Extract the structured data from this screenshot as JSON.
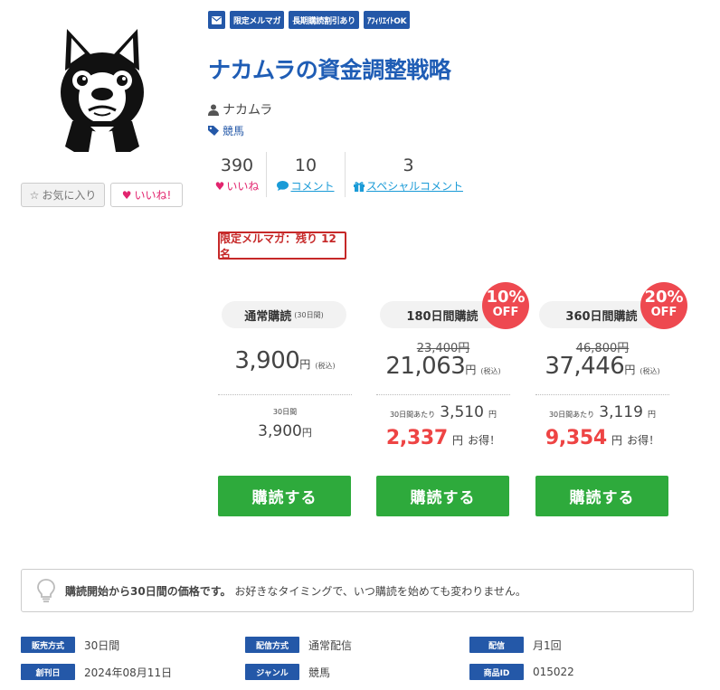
{
  "badges": [
    "限定メルマガ",
    "長期購読割引あり",
    "ｱﾌｨﾘｴｲﾄOK"
  ],
  "title": "ナカムラの資金調整戦略",
  "author": "ナカムラ",
  "genre": "競馬",
  "buttons": {
    "favorite": "お気に入り",
    "like": "いいね!"
  },
  "stats": [
    {
      "value": "390",
      "label": "いいね"
    },
    {
      "value": "10",
      "label": "コメント"
    },
    {
      "value": "3",
      "label": "スペシャルコメント"
    }
  ],
  "limited": "限定メルマガ：残り 12名",
  "plans": [
    {
      "name": "通常購読",
      "duration": "(30日間)",
      "price": "3,900",
      "yen": "円",
      "tax": "(税込)",
      "per_label": "30日間",
      "per_value": "3,900",
      "per_yen": "円",
      "buy": "購読する"
    },
    {
      "name": "180日間購読",
      "old_price": "23,400円",
      "price": "21,063",
      "yen": "円",
      "tax": "(税込)",
      "per_label": "30日間あたり",
      "per_value": "3,510",
      "per_yen": "円",
      "save_value": "2,337",
      "save_yen": "円",
      "save_text": "お得！",
      "discount_pct": "10%",
      "discount_text": "OFF",
      "buy": "購読する"
    },
    {
      "name": "360日間購読",
      "old_price": "46,800円",
      "price": "37,446",
      "yen": "円",
      "tax": "(税込)",
      "per_label": "30日間あたり",
      "per_value": "3,119",
      "per_yen": "円",
      "save_value": "9,354",
      "save_yen": "円",
      "save_text": "お得！",
      "discount_pct": "20%",
      "discount_text": "OFF",
      "buy": "購読する"
    }
  ],
  "notice": {
    "bold": "購読開始から30日間の価格です。",
    "text": "お好きなタイミングで、いつ購読を始めても変わりません。"
  },
  "meta": [
    {
      "key": "販売方式",
      "value": "30日間"
    },
    {
      "key": "配信方式",
      "value": "通常配信"
    },
    {
      "key": "配信",
      "value": "月1回"
    },
    {
      "key": "創刊日",
      "value": "2024年08月11日"
    },
    {
      "key": "ジャンル",
      "value": "競馬"
    },
    {
      "key": "商品ID",
      "value": "015022"
    }
  ],
  "colors": {
    "brand": "#2458a8",
    "title": "#1f5db5",
    "like": "#e2246e",
    "link": "#1a9bd7",
    "buy": "#2eaa3c",
    "save": "#ee4444",
    "discount": "#ee4950",
    "limited": "#c62828"
  },
  "icons": [
    "bulldog-avatar",
    "mail-icon",
    "user-icon",
    "tag-icon",
    "heart-icon",
    "comment-icon",
    "gift-icon",
    "star-icon",
    "lightbulb-icon"
  ]
}
